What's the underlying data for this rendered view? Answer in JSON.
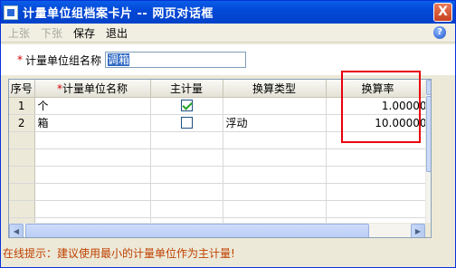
{
  "window": {
    "title": "计量单位组档案卡片 -- 网页对话框",
    "close_glyph": "X"
  },
  "toolbar": {
    "prev": "上张",
    "next": "下张",
    "save": "保存",
    "exit": "退出",
    "help_glyph": "?"
  },
  "form": {
    "required_mark": "*",
    "name_label": "计量单位组名称",
    "name_value": "调箱"
  },
  "grid": {
    "columns": {
      "seq": "序号",
      "name_required": "*",
      "name": "计量单位名称",
      "main": "主计量",
      "type": "换算类型",
      "rate": "换算率"
    },
    "rows": [
      {
        "seq": "1",
        "name": "个",
        "main": true,
        "type": "",
        "rate": "1.00000"
      },
      {
        "seq": "2",
        "name": "箱",
        "main": false,
        "type": "浮动",
        "rate": "10.00000"
      }
    ]
  },
  "hint": "在线提示：建议使用最小的计量单位作为主计量!",
  "colors": {
    "highlight_box": "#e8000c",
    "hint_text": "#c04000",
    "title_bar": "#0348d8"
  }
}
